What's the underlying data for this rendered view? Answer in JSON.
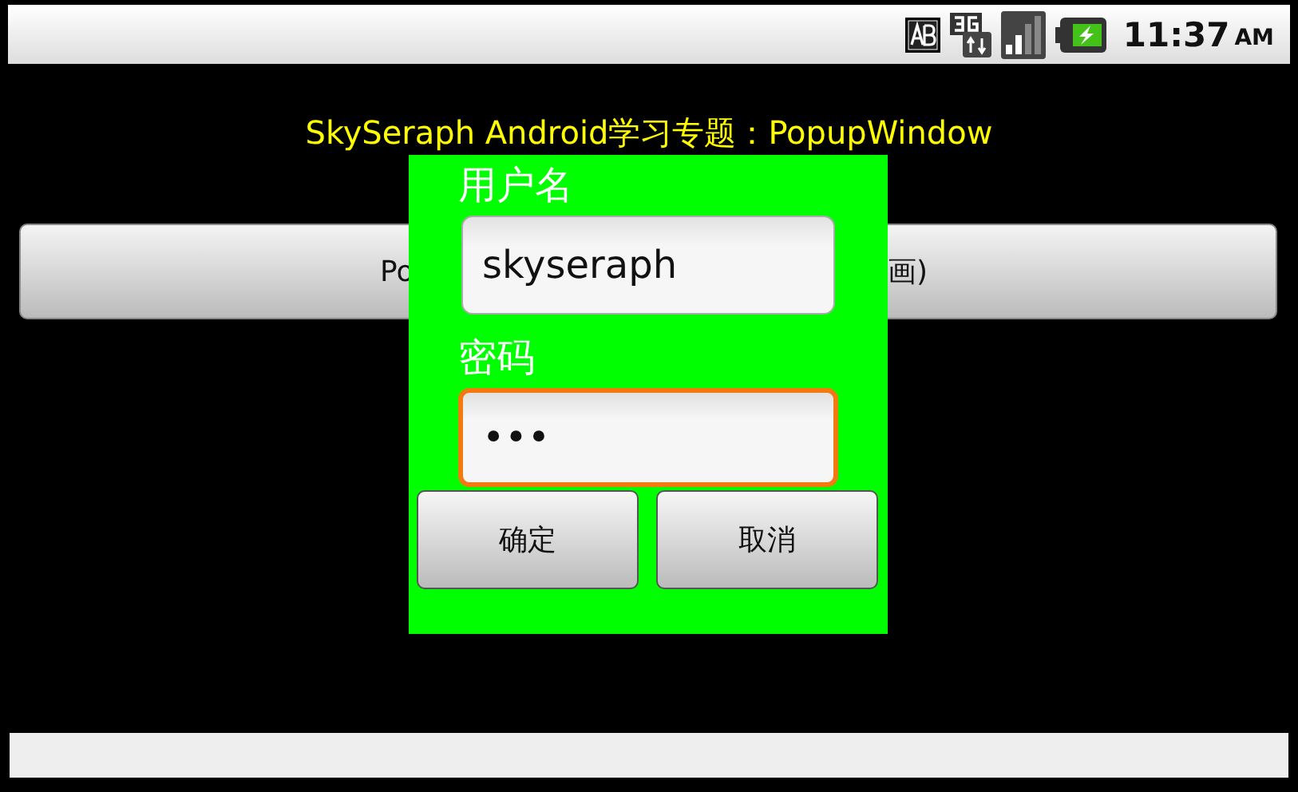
{
  "status_bar": {
    "time": "11:37",
    "meridiem": "AM"
  },
  "title": "SkySeraph Android学习专题：PopupWindow",
  "background_button": {
    "text_left": "Po",
    "text_right": "画)"
  },
  "popup": {
    "username_label": "用户名",
    "username_value": "skyseraph",
    "password_label": "密码",
    "password_value": "•••",
    "password_focused": true,
    "buttons": [
      "确定",
      "取消"
    ]
  }
}
